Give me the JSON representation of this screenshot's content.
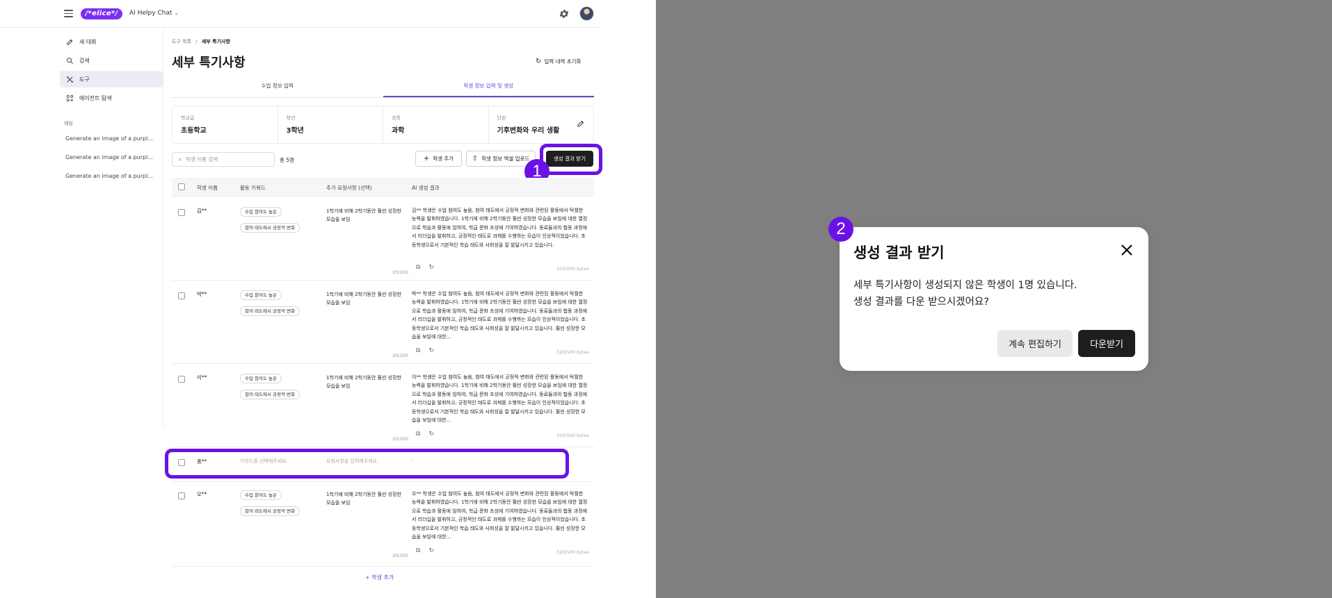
{
  "header": {
    "logo": "/*elice*/",
    "app_title": "AI Helpy Chat",
    "chevron": "⌄"
  },
  "sidebar": {
    "nav": [
      {
        "label": "새 대화",
        "icon": "edit-icon"
      },
      {
        "label": "검색",
        "icon": "search-icon"
      },
      {
        "label": "도구",
        "icon": "tools-icon"
      },
      {
        "label": "에이전트 탐색",
        "icon": "grid-icon"
      }
    ],
    "section_label": "채팅",
    "chats": [
      "Generate an image of a purpl...",
      "Generate an image of a purpl...",
      "Generate an image of a purpl..."
    ]
  },
  "main": {
    "breadcrumb_parent": "도구 목록",
    "breadcrumb_sep": "/",
    "breadcrumb_current": "세부 특기사항",
    "title": "세부 특기사항",
    "reset_label": "입력 내역 초기화",
    "tabs": [
      "수업 정보 입력",
      "학생 정보 입력 및 생성"
    ],
    "info": [
      {
        "label": "학교급",
        "value": "초등학교"
      },
      {
        "label": "학년",
        "value": "3학년"
      },
      {
        "label": "과목",
        "value": "과학"
      },
      {
        "label": "단원",
        "value": "기후변화와 우리 생활"
      }
    ],
    "search_placeholder": "학생 이름 검색",
    "total": "총 5명",
    "add_student_label": "학생 추가",
    "upload_label": "학생 정보 엑셀 업로드",
    "generate_label": "생성 결과 받기",
    "columns": [
      "학생 이름",
      "활동 키워드",
      "추가 요청사항 (선택)",
      "AI 생성 결과"
    ],
    "rows": [
      {
        "name": "김**",
        "chips": [
          "수업 참여도 높은",
          "참여 태도에서 긍정적 변화"
        ],
        "request": "1학기에 비해 2학기동안 훨씬 성장한 모습을 보임",
        "req_count": "20/200",
        "ai": "김** 학생은 수업 참여도 높음, 참여 태도에서 긍정적 변화와 관련된 활동에서 탁월한 능력을 발휘하였습니다. 1학기에 비해 2학기동안 훨씬 성장한 모습을 보임에 대한 열정으로 학습과 활동에 임하여, 학급 문화 조성에 기여하였습니다. 동료들과의 협동 과정에서 리더십을 발휘하고, 긍정적인 태도로 과제를 수행하는 모습이 인상적이었습니다. 초등학생으로서 기본적인 학습 태도와 사회성을 잘 발달시키고 있습니다.",
        "bytes": "320/500 bytes"
      },
      {
        "name": "박**",
        "chips": [
          "수업 참여도 높은",
          "참여 태도에서 긍정적 변화"
        ],
        "request": "1학기에 비해 2학기동안 훨씬 성장한 모습을 보임",
        "req_count": "20/200",
        "ai": "박** 학생은 수업 참여도 높음, 참여 태도에서 긍정적 변화와 관련된 활동에서 탁월한 능력을 발휘하였습니다. 1학기에 비해 2학기동안 훨씬 성장한 모습을 보임에 대한 열정으로 학습과 활동에 임하여, 학급 문화 조성에 기여하였습니다. 동료들과의 협동 과정에서 리더십을 발휘하고, 긍정적인 태도로 과제를 수행하는 모습이 인상적이었습니다. 초등학생으로서 기본적인 학습 태도와 사회성을 잘 발달시키고 있습니다. 훨씬 성장한 모습을 보임에 대한...",
        "bytes": "320/500 bytes"
      },
      {
        "name": "이**",
        "chips": [
          "수업 참여도 높은",
          "참여 태도에서 긍정적 변화"
        ],
        "request": "1학기에 비해 2학기동안 훨씬 성장한 모습을 보임",
        "req_count": "20/200",
        "ai": "이** 학생은 수업 참여도 높음, 참여 태도에서 긍정적 변화와 관련된 활동에서 탁월한 능력을 발휘하였습니다. 1학기에 비해 2학기동안 훨씬 성장한 모습을 보임에 대한 열정으로 학습과 활동에 임하여, 학급 문화 조성에 기여하였습니다. 동료들과의 협동 과정에서 리더십을 발휘하고, 긍정적인 태도로 과제를 수행하는 모습이 인상적이었습니다. 초등학생으로서 기본적인 학습 태도와 사회성을 잘 발달시키고 있습니다. 훨씬 성장한 모습을 보임에 대한...",
        "bytes": "320/500 bytes"
      },
      {
        "name": "홍**",
        "keyword_placeholder": "키워드를 선택해주세요.",
        "request_placeholder": "요청사항을 입력해주세요.",
        "ai": "-"
      },
      {
        "name": "오**",
        "chips": [
          "수업 참여도 높은",
          "참여 태도에서 긍정적 변화"
        ],
        "request": "1학기에 비해 2학기동안 훨씬 성장한 모습을 보임",
        "req_count": "20/200",
        "ai": "오** 학생은 수업 참여도 높음, 참여 태도에서 긍정적 변화와 관련된 활동에서 탁월한 능력을 발휘하였습니다. 1학기에 비해 2학기동안 훨씬 성장한 모습을 보임에 대한 열정으로 학습과 활동에 임하여, 학급 문화 조성에 기여하였습니다. 동료들과의 협동 과정에서 리더십을 발휘하고, 긍정적인 태도로 과제를 수행하는 모습이 인상적이었습니다. 초등학생으로서 기본적인 학습 태도와 사회성을 잘 발달시키고 있습니다. 훨씬 성장한 모습을 보임에 대한...",
        "bytes": "320/500 bytes"
      }
    ],
    "add_student_bottom": "학생 추가"
  },
  "callouts": {
    "one": "1",
    "two": "2"
  },
  "dialog": {
    "title": "생성 결과 받기",
    "message_line1": "세부 특기사항이 생성되지 않은 학생이 1명 있습니다.",
    "message_line2": "생성 결과를 다운 받으시겠어요?",
    "continue_label": "계속 편집하기",
    "download_label": "다운받기"
  },
  "colors": {
    "accent": "#6a12e6",
    "brand": "#7b2ff2",
    "overlay": "#7f7f7f",
    "primary_button": "#1e1e1e"
  }
}
